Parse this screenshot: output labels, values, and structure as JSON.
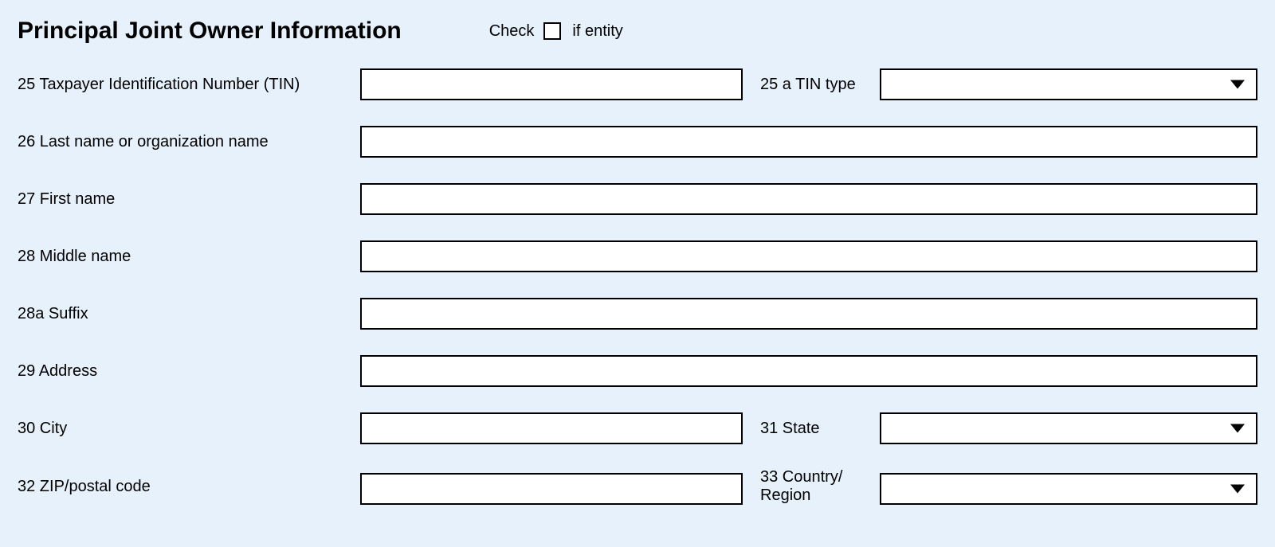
{
  "section_title": "Principal Joint Owner Information",
  "entity_check": {
    "left": "Check",
    "right": "if entity",
    "checked": false
  },
  "fields": {
    "f25": {
      "label": "25 Taxpayer Identification Number (TIN)",
      "value": ""
    },
    "f25a": {
      "label": "25 a TIN type",
      "value": ""
    },
    "f26": {
      "label": "26  Last name  or organization name",
      "value": ""
    },
    "f27": {
      "label": "27  First name",
      "value": ""
    },
    "f28": {
      "label": "28  Middle name",
      "value": ""
    },
    "f28a": {
      "label": "28a Suffix",
      "value": ""
    },
    "f29": {
      "label": "29  Address",
      "value": ""
    },
    "f30": {
      "label": "30  City",
      "value": ""
    },
    "f31": {
      "label": "31 State",
      "value": ""
    },
    "f32": {
      "label": "32 ZIP/postal code",
      "value": ""
    },
    "f33": {
      "label_line1": "33 Country/",
      "label_line2": "Region",
      "value": ""
    }
  }
}
